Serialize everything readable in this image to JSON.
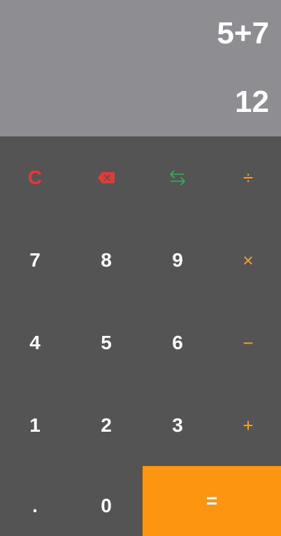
{
  "display": {
    "expression": "5+7",
    "result": "12"
  },
  "keys": {
    "clear": "C",
    "backspace_icon": "backspace-icon",
    "swap_icon": "swap-arrows-icon",
    "divide": "÷",
    "seven": "7",
    "eight": "8",
    "nine": "9",
    "multiply": "×",
    "four": "4",
    "five": "5",
    "six": "6",
    "minus": "−",
    "one": "1",
    "two": "2",
    "three": "3",
    "plus": "+",
    "decimal": ".",
    "zero": "0",
    "equals": "="
  },
  "colors": {
    "display_bg": "#8e8d92",
    "keypad_bg": "#545454",
    "operator": "#f6a623",
    "clear": "#e53935",
    "swap": "#2fb356",
    "equals_bg": "#fd9510"
  }
}
